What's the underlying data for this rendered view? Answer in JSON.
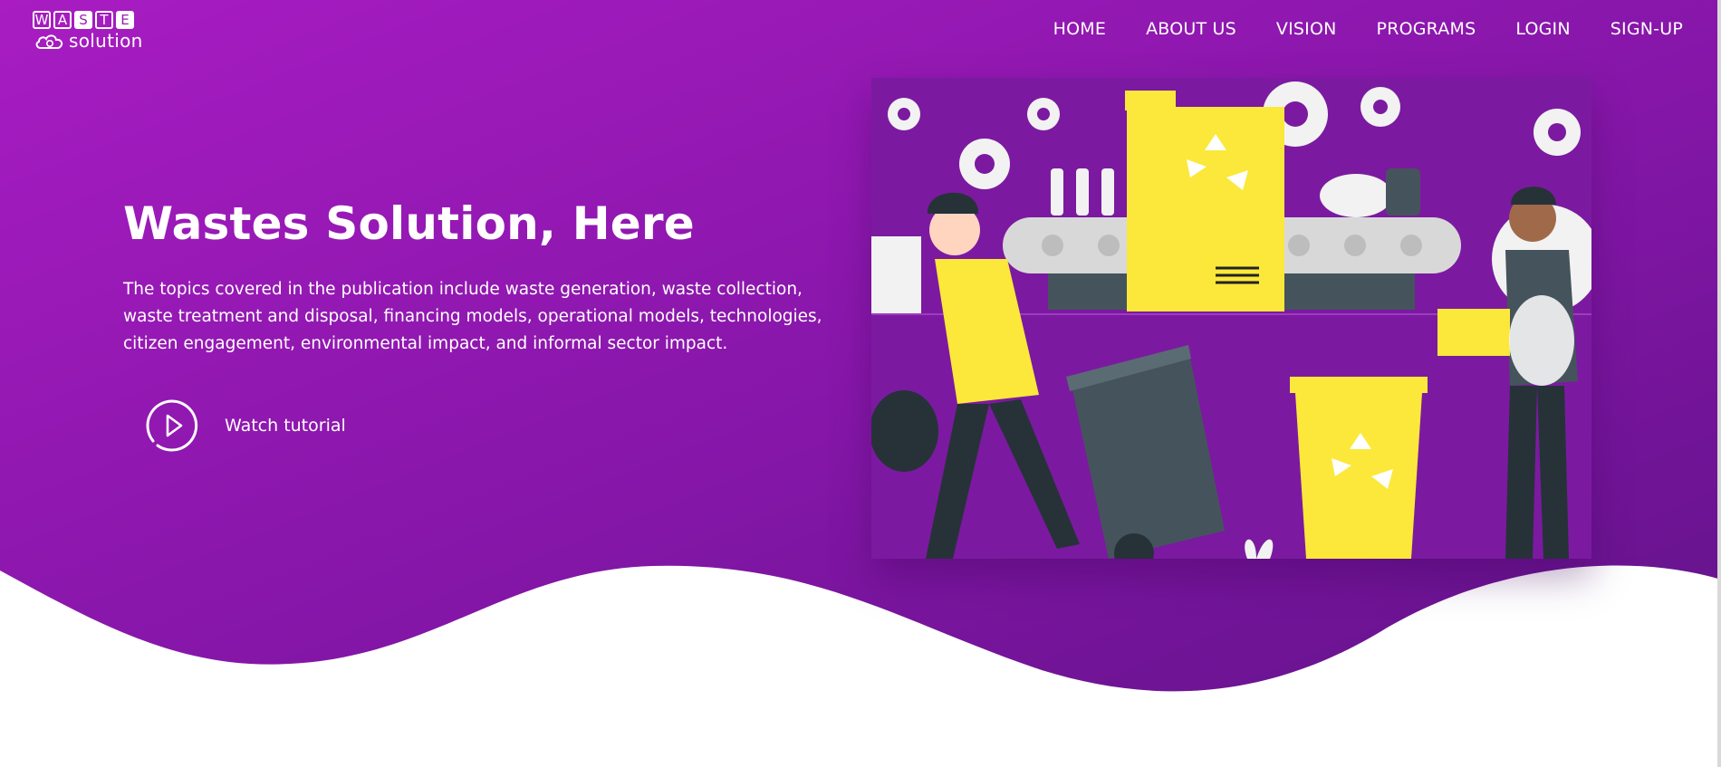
{
  "logo": {
    "letters": [
      "W",
      "A",
      "S",
      "T",
      "E"
    ],
    "subtitle": "solution",
    "icon": "cloud-recycle-icon"
  },
  "nav": {
    "items": [
      {
        "label": "HOME"
      },
      {
        "label": "ABOUT US"
      },
      {
        "label": "VISION"
      },
      {
        "label": "PROGRAMS"
      },
      {
        "label": "LOGIN"
      },
      {
        "label": "SIGN-UP"
      }
    ]
  },
  "hero": {
    "title": "Wastes Solution, Here",
    "description": "The topics covered in the publication include waste generation, waste collection, waste treatment and disposal, financing models, operational models, technologies, citizen engagement, environmental impact, and informal sector impact.",
    "cta_label": "Watch tutorial",
    "cta_icon": "play-circle-icon"
  },
  "colors": {
    "gradient_start": "#a31bbf",
    "gradient_end": "#6a1591",
    "accent_yellow": "#fbe83b",
    "dark_gray": "#45545c"
  }
}
